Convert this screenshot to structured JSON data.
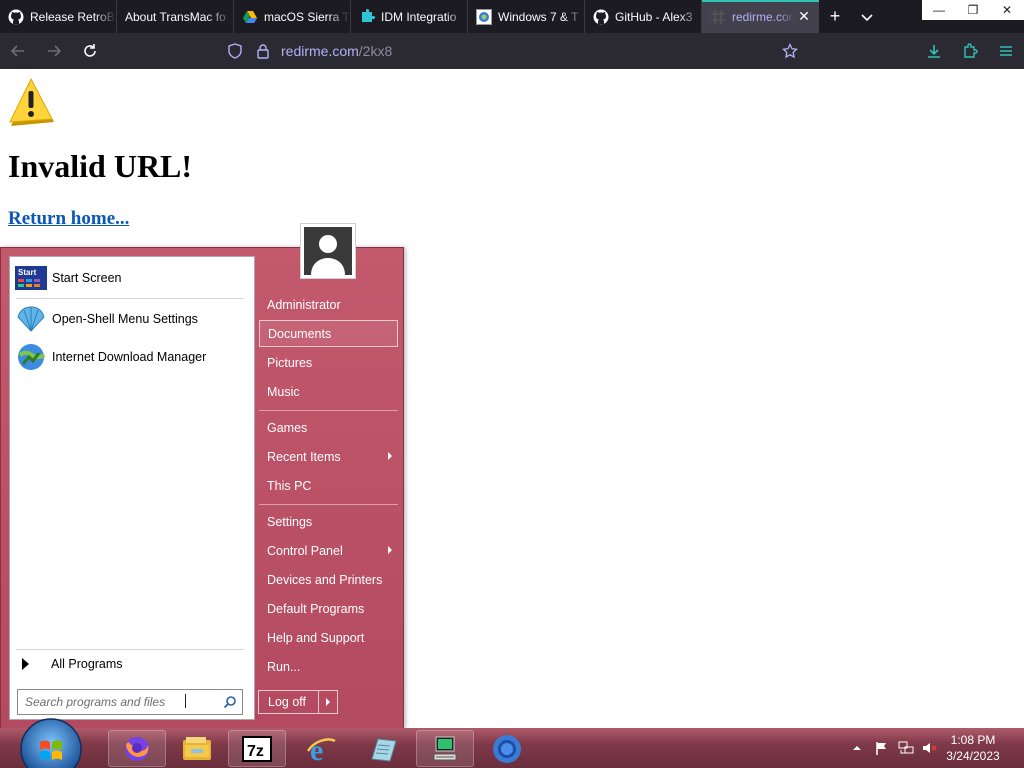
{
  "browser": {
    "tabs": [
      {
        "label": "Release RetroB",
        "icon": "github-icon",
        "active": false
      },
      {
        "label": "About TransMac fo",
        "icon": "blank-icon",
        "active": false
      },
      {
        "label": "macOS Sierra T",
        "icon": "google-drive-icon",
        "active": false
      },
      {
        "label": "IDM Integratio",
        "icon": "puzzle-icon",
        "active": false
      },
      {
        "label": "Windows 7 & T",
        "icon": "windows-icon",
        "active": false
      },
      {
        "label": "GitHub - Alex3",
        "icon": "github-icon",
        "active": false
      },
      {
        "label": "redirme.com",
        "icon": "grid-icon",
        "active": true
      }
    ],
    "address": {
      "host": "redirme.com",
      "path": "/2kx8"
    },
    "accent": "#2ec4b6"
  },
  "page": {
    "heading": "Invalid URL!",
    "link": "Return home..."
  },
  "start_menu": {
    "programs": [
      {
        "label": "Start Screen",
        "icon": "start-screen-icon"
      },
      {
        "label": "Open-Shell Menu Settings",
        "icon": "shell-icon"
      },
      {
        "label": "Internet Download Manager",
        "icon": "idm-icon"
      }
    ],
    "all_programs": "All Programs",
    "search_placeholder": "Search programs and files",
    "user": "Administrator",
    "right_items": [
      {
        "label": "Documents",
        "highlighted": true,
        "submenu": false
      },
      {
        "label": "Pictures",
        "highlighted": false,
        "submenu": false
      },
      {
        "label": "Music",
        "highlighted": false,
        "submenu": false
      },
      {
        "label": "Games",
        "highlighted": false,
        "submenu": false
      },
      {
        "label": "Recent Items",
        "highlighted": false,
        "submenu": true
      },
      {
        "label": "This PC",
        "highlighted": false,
        "submenu": false
      },
      {
        "label": "Settings",
        "highlighted": false,
        "submenu": false
      },
      {
        "label": "Control Panel",
        "highlighted": false,
        "submenu": true
      },
      {
        "label": "Devices and Printers",
        "highlighted": false,
        "submenu": false
      },
      {
        "label": "Default Programs",
        "highlighted": false,
        "submenu": false
      },
      {
        "label": "Help and Support",
        "highlighted": false,
        "submenu": false
      },
      {
        "label": "Run...",
        "highlighted": false,
        "submenu": false
      }
    ],
    "log_off": "Log off",
    "accent": "#b44a60"
  },
  "taskbar": {
    "apps": [
      "firefox-icon",
      "file-explorer-icon",
      "7zip-icon",
      "internet-explorer-icon",
      "notepad-icon",
      "computer-icon",
      "chrome-icon"
    ],
    "time": "1:08 PM",
    "date": "3/24/2023"
  }
}
